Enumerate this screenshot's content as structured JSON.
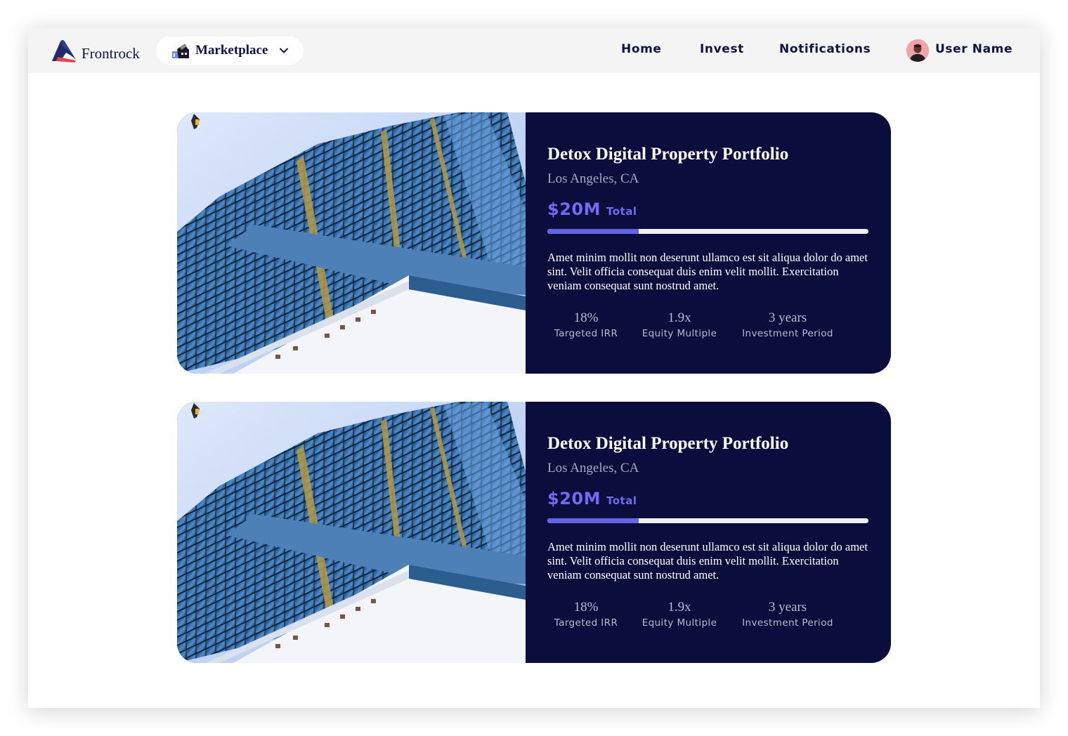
{
  "header": {
    "brand": "Frontrock",
    "marketplace_label": "Marketplace",
    "nav": [
      "Home",
      "Invest",
      "Notifications"
    ],
    "user_name": "User Name"
  },
  "colors": {
    "navy": "#0b0e3d",
    "accent": "#6f6cf2",
    "header_bg": "#f4f4f5"
  },
  "cards": [
    {
      "title": "Detox Digital Property Portfolio",
      "location": "Los Angeles, CA",
      "amount": "$20M",
      "amount_unit": "Total",
      "progress": 0.285,
      "description": "Amet minim mollit non deserunt ullamco est sit aliqua dolor do amet sint. Velit officia consequat duis enim velit mollit. Exercitation veniam consequat sunt nostrud amet.",
      "stats": [
        {
          "value": "18%",
          "label": "Targeted IRR"
        },
        {
          "value": "1.9x",
          "label": "Equity Multiple"
        },
        {
          "value": "3 years",
          "label": "Investment Period"
        }
      ]
    },
    {
      "title": "Detox Digital Property Portfolio",
      "location": "Los Angeles, CA",
      "amount": "$20M",
      "amount_unit": "Total",
      "progress": 0.285,
      "description": "Amet minim mollit non deserunt ullamco est sit aliqua dolor do amet sint. Velit officia consequat duis enim velit mollit. Exercitation veniam consequat sunt nostrud amet.",
      "stats": [
        {
          "value": "18%",
          "label": "Targeted IRR"
        },
        {
          "value": "1.9x",
          "label": "Equity Multiple"
        },
        {
          "value": "3 years",
          "label": "Investment Period"
        }
      ]
    }
  ]
}
